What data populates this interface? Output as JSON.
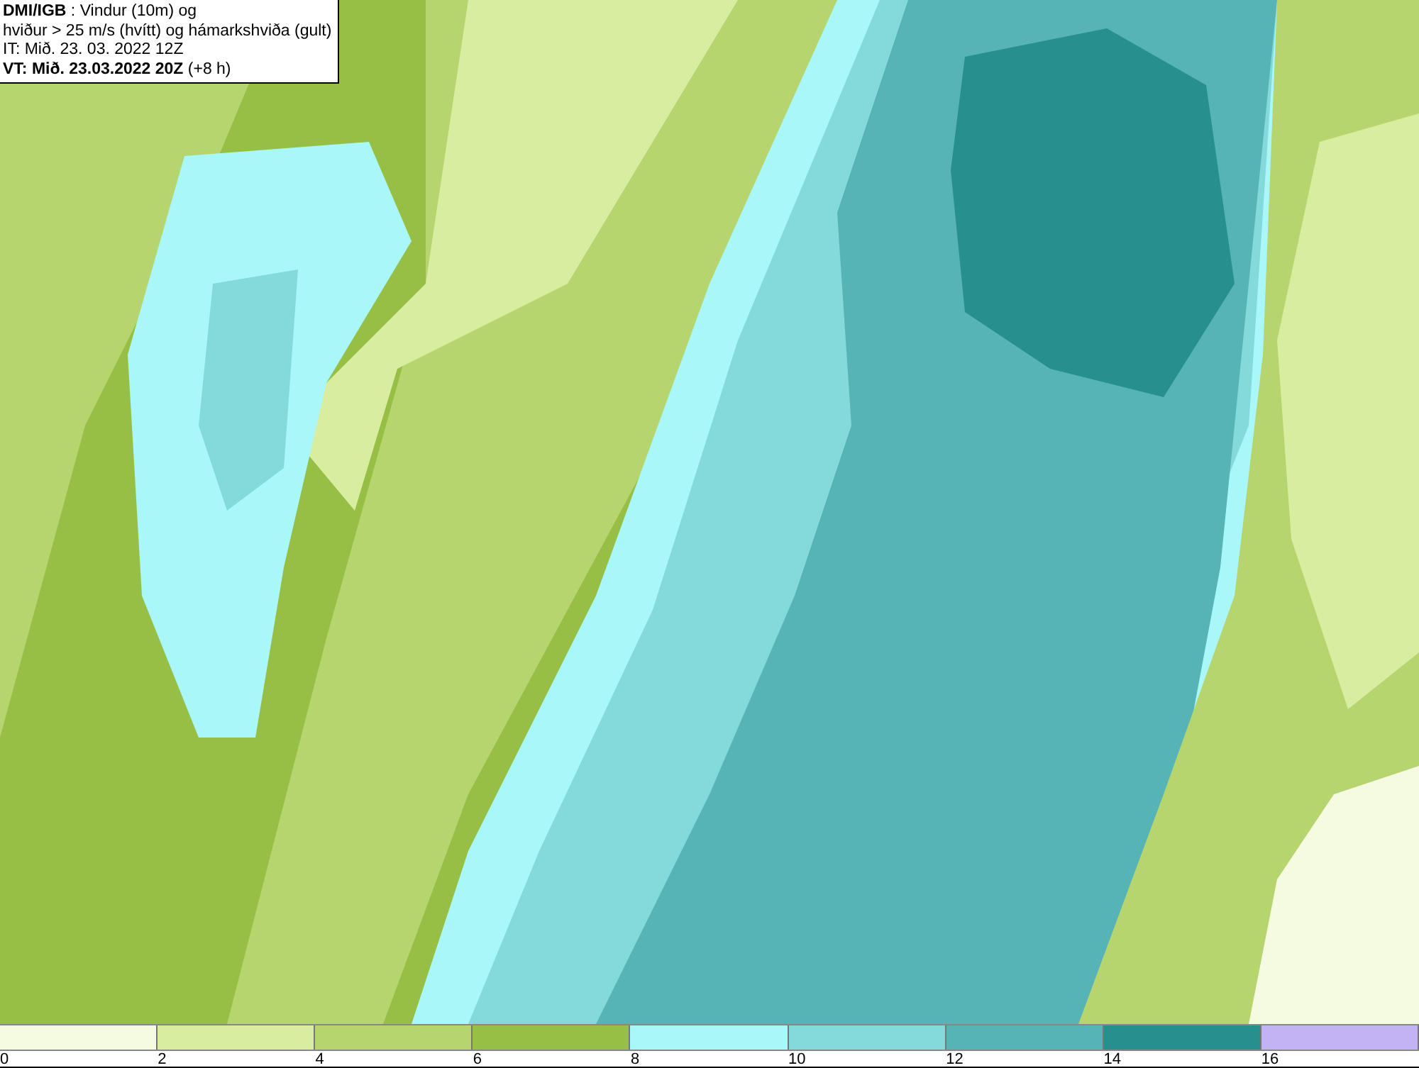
{
  "info_box": {
    "lines": [
      "**DMI/IGB** : Vindur (10m) og",
      "hviður > 25 m/s (hvítt) og hámarkshviða (gult)",
      "IT: Mið. 23. 03. 2022 12Z",
      "**VT: Mið. 23.03.2022 20Z** (+8 h)"
    ]
  },
  "legend": {
    "bins": [
      {
        "color": "#f4fbe0"
      },
      {
        "color": "#d8eda0"
      },
      {
        "color": "#b6d56e"
      },
      {
        "color": "#98bf45"
      },
      {
        "color": "#aaf7f9"
      },
      {
        "color": "#84d9da"
      },
      {
        "color": "#57b4b6"
      },
      {
        "color": "#27908f"
      },
      {
        "color": "#c3b3f5"
      }
    ],
    "ticks": [
      "0",
      "2",
      "4",
      "6",
      "8",
      "10",
      "12",
      "14",
      "16"
    ]
  }
}
